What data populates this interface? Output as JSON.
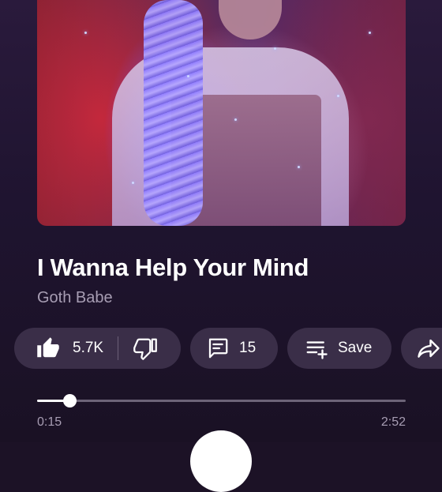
{
  "track": {
    "title": "I Wanna Help Your Mind",
    "artist": "Goth Babe"
  },
  "actions": {
    "like_count": "5.7K",
    "comment_count": "15",
    "save_label": "Save"
  },
  "playback": {
    "current_time": "0:15",
    "total_time": "2:52",
    "progress": 0.087
  },
  "icons": {
    "like": "thumbs-up-icon",
    "dislike": "thumbs-down-icon",
    "comment": "comment-icon",
    "save": "playlist-add-icon",
    "share": "share-icon"
  },
  "colors": {
    "background": "#1c1226",
    "pill": "#3a2e48",
    "secondary_text": "#a79db3",
    "track": "#6d6478"
  }
}
